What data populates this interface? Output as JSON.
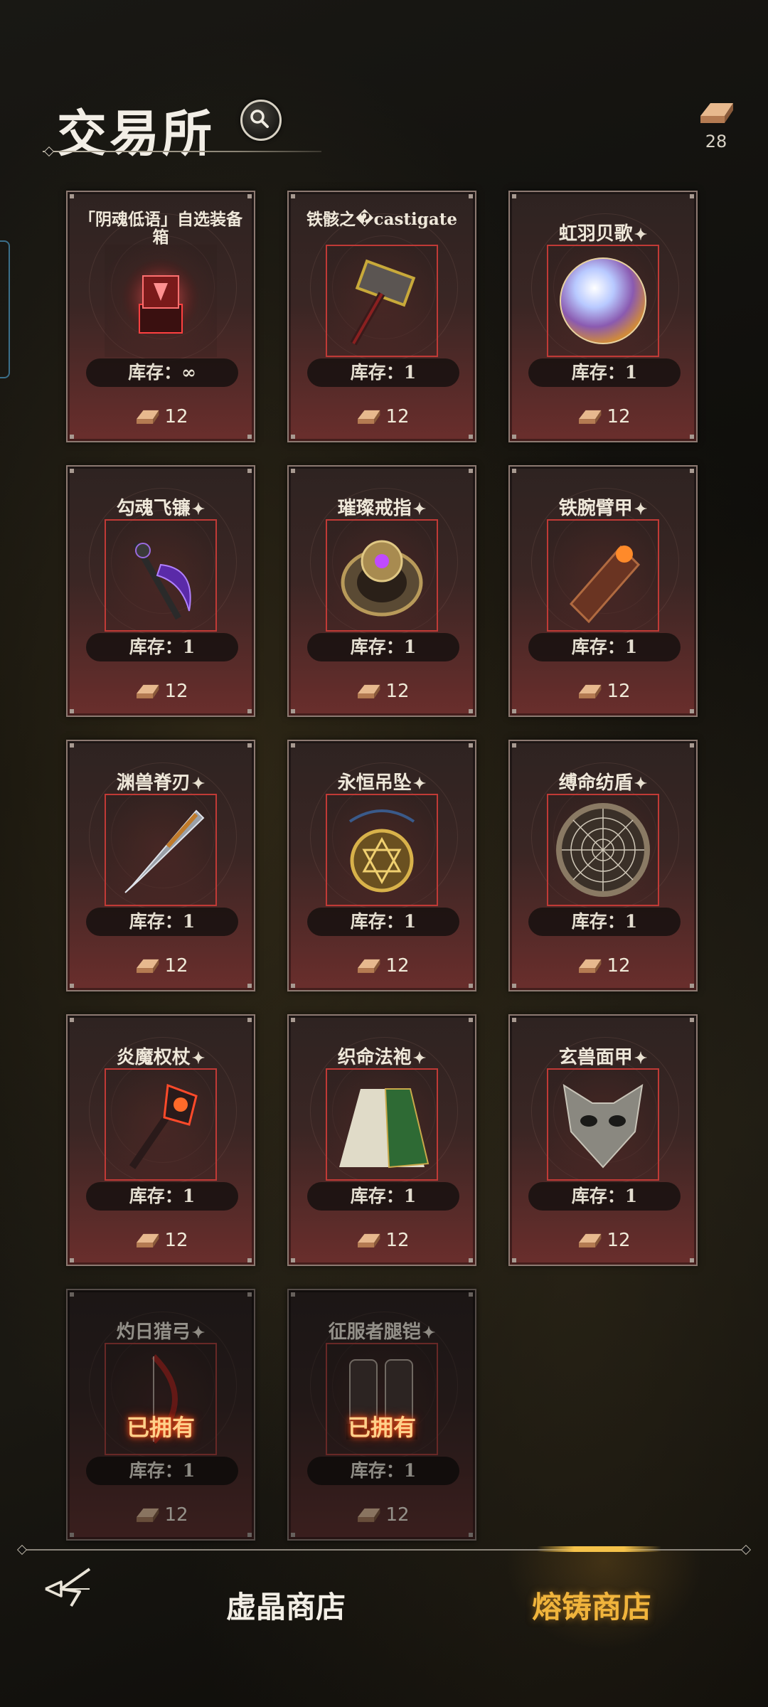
{
  "header": {
    "title": "交易所",
    "currency_amount": "28"
  },
  "colors": {
    "accent_gold": "#f0b43c",
    "item_frame_red": "#c03a36",
    "owned_glow": "#ff5a1f"
  },
  "items": [
    {
      "name": "「阴魂低语」自选装备箱",
      "stock": "库存：∞",
      "price": "12",
      "icon": "cursed-chest-icon",
      "owned": false
    },
    {
      "name": "铁骸之�castigate",
      "stock": "库存：1",
      "price": "12",
      "icon": "hammer-icon",
      "owned": false
    },
    {
      "name": "虹羽贝歌",
      "stock": "库存：1",
      "price": "12",
      "icon": "orb-icon",
      "owned": false
    },
    {
      "name": "勾魂飞镰",
      "stock": "库存：1",
      "price": "12",
      "icon": "scythe-icon",
      "owned": false
    },
    {
      "name": "璀璨戒指",
      "stock": "库存：1",
      "price": "12",
      "icon": "ring-icon",
      "owned": false
    },
    {
      "name": "铁腕臂甲",
      "stock": "库存：1",
      "price": "12",
      "icon": "bracer-icon",
      "owned": false
    },
    {
      "name": "渊兽脊刃",
      "stock": "库存：1",
      "price": "12",
      "icon": "spine-blade-icon",
      "owned": false
    },
    {
      "name": "永恒吊坠",
      "stock": "库存：1",
      "price": "12",
      "icon": "pendant-icon",
      "owned": false
    },
    {
      "name": "缚命纺盾",
      "stock": "库存：1",
      "price": "12",
      "icon": "web-shield-icon",
      "owned": false
    },
    {
      "name": "炎魔权杖",
      "stock": "库存：1",
      "price": "12",
      "icon": "scepter-icon",
      "owned": false
    },
    {
      "name": "织命法袍",
      "stock": "库存：1",
      "price": "12",
      "icon": "robe-icon",
      "owned": false
    },
    {
      "name": "玄兽面甲",
      "stock": "库存：1",
      "price": "12",
      "icon": "beast-mask-icon",
      "owned": false
    },
    {
      "name": "灼日猎弓",
      "stock": "库存：1",
      "price": "12",
      "icon": "bow-icon",
      "owned": true,
      "owned_label": "已拥有"
    },
    {
      "name": "征服者腿铠",
      "stock": "库存：1",
      "price": "12",
      "icon": "greaves-icon",
      "owned": true,
      "owned_label": "已拥有"
    }
  ],
  "bottom_nav": {
    "tab_store": "虚晶商店",
    "tab_forge": "熔铸商店",
    "active": "熔铸商店"
  }
}
